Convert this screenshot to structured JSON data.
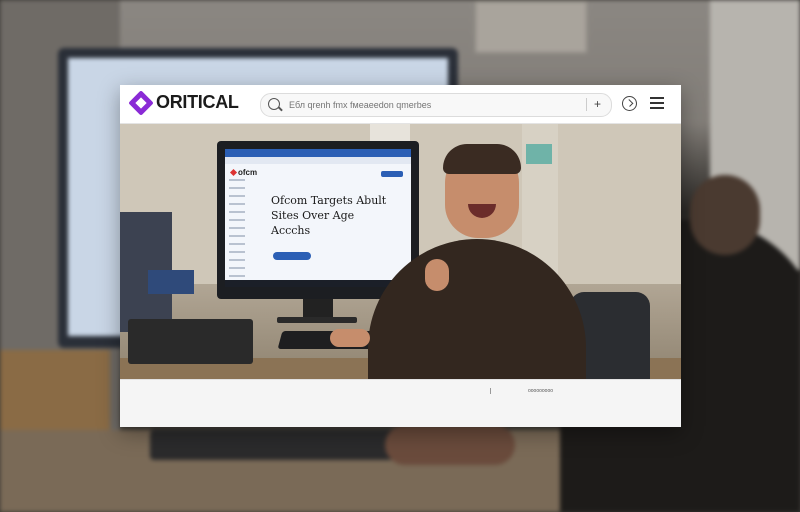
{
  "brand": {
    "name": "ORITICAL"
  },
  "search": {
    "placeholder": "Ебл qrenh fmx fмeaeedon qmerbes"
  },
  "header_icons": [
    "search-icon",
    "plus-icon",
    "download-icon",
    "menu-icon"
  ],
  "hero": {
    "screen_site_logo": "ofcm",
    "screen_headline": "Ofcom Targets Abult\nSites Over Age\nAccchs"
  },
  "footer": {
    "caption": "ooooooooo"
  },
  "colors": {
    "brand_purple": "#8a2ad6",
    "accent_blue": "#2b5fb5"
  }
}
